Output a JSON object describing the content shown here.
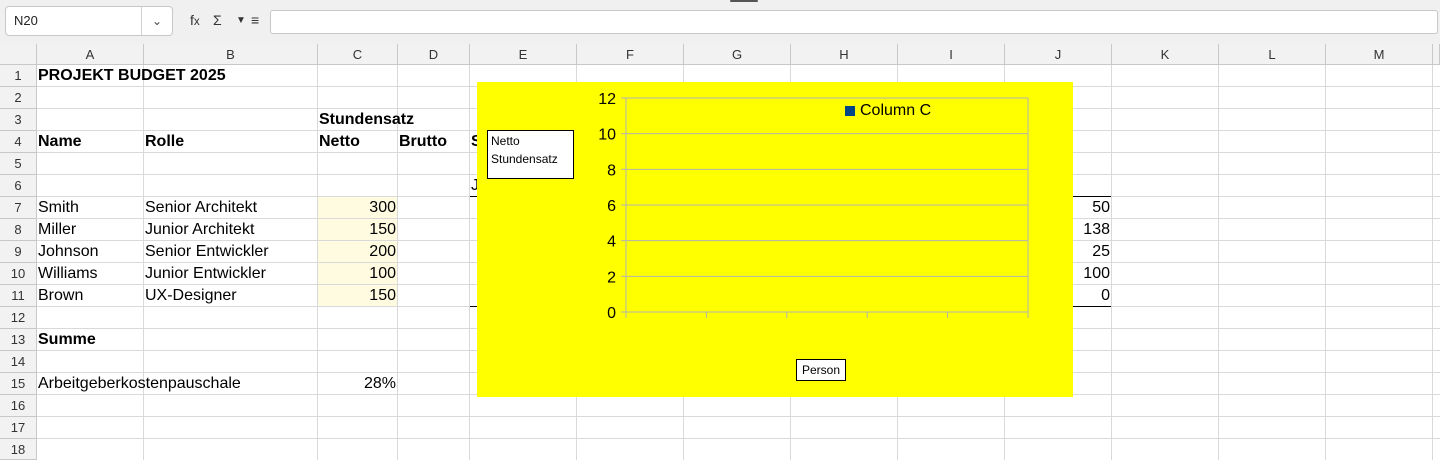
{
  "toolbar": {
    "name_box": "N20",
    "formula": ""
  },
  "columns": [
    "A",
    "B",
    "C",
    "D",
    "E",
    "F",
    "G",
    "H",
    "I",
    "J",
    "K",
    "L",
    "M"
  ],
  "rows": [
    "1",
    "2",
    "3",
    "4",
    "5",
    "6",
    "7",
    "8",
    "9",
    "10",
    "11",
    "12",
    "13",
    "14",
    "15",
    "16",
    "17",
    "18"
  ],
  "sheet": {
    "title": "PROJEKT BUDGET 2025",
    "header_stundensatz": "Stundensatz",
    "header_name": "Name",
    "header_rolle": "Rolle",
    "header_netto": "Netto",
    "header_brutto": "Brutto",
    "header_cut": "S",
    "cut_e6": "J",
    "people": [
      {
        "name": "Smith",
        "role": "Senior Architekt",
        "netto": "300",
        "j": "50"
      },
      {
        "name": "Miller",
        "role": "Junior Architekt",
        "netto": "150",
        "j": "138"
      },
      {
        "name": "Johnson",
        "role": "Senior Entwickler",
        "netto": "200",
        "j": "25"
      },
      {
        "name": "Williams",
        "role": "Junior Entwickler",
        "netto": "100",
        "j": "100"
      },
      {
        "name": "Brown",
        "role": "UX-Designer",
        "netto": "150",
        "j": "0"
      }
    ],
    "summe": "Summe",
    "pauschale_label": "Arbeitgeberkostenpauschale",
    "pauschale_value": "28%"
  },
  "chart_data": {
    "type": "bar",
    "background": "#ffff00",
    "series": [
      {
        "name": "Column C",
        "color": "#004586",
        "values": []
      }
    ],
    "categories": [
      "",
      "",
      "",
      "",
      "",
      ""
    ],
    "ylabel": "Netto Stundensatz",
    "xlabel": "Person",
    "ylim": [
      0,
      12
    ],
    "yticks": [
      "0",
      "2",
      "4",
      "6",
      "8",
      "10",
      "12"
    ],
    "legend_position": "top-right"
  }
}
